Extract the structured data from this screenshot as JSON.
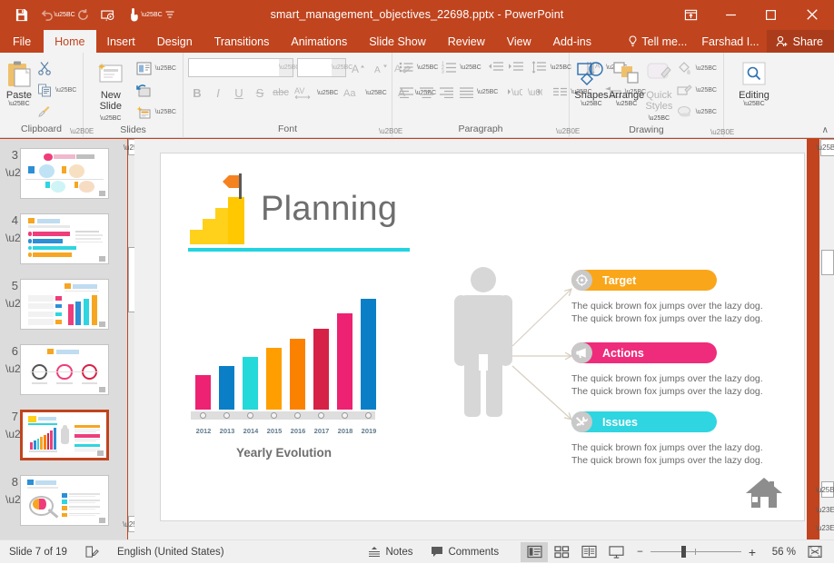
{
  "window": {
    "title": "smart_management_objectives_22698.pptx - PowerPoint",
    "accent_color": "#C0441E",
    "quick_access": [
      {
        "name": "save",
        "glyph": "ὋE"
      },
      {
        "name": "undo",
        "glyph": "↶"
      },
      {
        "name": "redo",
        "glyph": "↻"
      },
      {
        "name": "start-presentation",
        "glyph": "▶"
      },
      {
        "name": "touch-mode",
        "glyph": "☝"
      },
      {
        "name": "customize-qat",
        "glyph": "⯆"
      }
    ],
    "controls": {
      "ribbon_display": "⤒",
      "minimize": "—",
      "maximize": "□",
      "close": "✕"
    }
  },
  "ribbon": {
    "tabs": [
      {
        "label": "File",
        "active": false
      },
      {
        "label": "Home",
        "active": true
      },
      {
        "label": "Insert",
        "active": false
      },
      {
        "label": "Design",
        "active": false
      },
      {
        "label": "Transitions",
        "active": false
      },
      {
        "label": "Animations",
        "active": false
      },
      {
        "label": "Slide Show",
        "active": false
      },
      {
        "label": "Review",
        "active": false
      },
      {
        "label": "View",
        "active": false
      },
      {
        "label": "Add-ins",
        "active": false
      }
    ],
    "tell_me": "Tell me...",
    "user_name": "Farshad I...",
    "share_label": "Share",
    "collapse_glyph": "∧",
    "groups": {
      "clipboard": {
        "label": "Clipboard",
        "paste_label": "Paste",
        "items": [
          "Cut",
          "Copy",
          "Format Painter"
        ]
      },
      "slides": {
        "label": "Slides",
        "new_slide_label": "New\nSlide",
        "new_slide_line1": "New",
        "new_slide_line2": "Slide",
        "items": [
          "Layout",
          "Reset",
          "Section"
        ]
      },
      "font": {
        "label": "Font",
        "font_name_value": "",
        "font_name_placeholder": "",
        "font_size_value": "",
        "font_size_placeholder": "",
        "buttons": [
          "B",
          "I",
          "U",
          "S",
          "abc",
          "AV",
          "Aa",
          "A"
        ]
      },
      "paragraph": {
        "label": "Paragraph"
      },
      "drawing": {
        "label": "Drawing",
        "shapes_label": "Shapes",
        "arrange_label": "Arrange",
        "quick_styles_line1": "Quick",
        "quick_styles_line2": "Styles"
      },
      "editing": {
        "label": "Editing",
        "editing_label": "Editing"
      }
    }
  },
  "thumbnails": [
    {
      "number": "3",
      "selected": false,
      "starred": true,
      "title": "Specific Milestones"
    },
    {
      "number": "4",
      "selected": false,
      "starred": true,
      "title": "Measurable"
    },
    {
      "number": "5",
      "selected": false,
      "starred": true,
      "title": "Measurable"
    },
    {
      "number": "6",
      "selected": false,
      "starred": true,
      "title": "Attainable"
    },
    {
      "number": "7",
      "selected": true,
      "starred": true,
      "title": "Planning"
    },
    {
      "number": "8",
      "selected": false,
      "starred": true,
      "title": "Relevant"
    }
  ],
  "slide": {
    "title": "Planning",
    "title_color": "#6E6E6E",
    "underline_color": "#22D3E0",
    "chart_caption": "Yearly Evolution",
    "home_icon": "home-icon",
    "items": [
      {
        "label": "Target",
        "color": "#FAA61A",
        "icon": "target-crosshair-icon",
        "body_line1": "The quick brown fox jumps over the lazy dog.",
        "body_line2": "The quick brown fox jumps over the lazy dog."
      },
      {
        "label": "Actions",
        "color": "#EE2C7B",
        "icon": "megaphone-icon",
        "body_line1": "The quick brown fox jumps over the lazy dog.",
        "body_line2": "The quick brown fox jumps over the lazy dog."
      },
      {
        "label": "Issues",
        "color": "#2FD5E0",
        "icon": "tools-icon",
        "body_line1": "The quick brown fox jumps over the lazy dog.",
        "body_line2": "The quick brown fox jumps over the lazy dog."
      }
    ]
  },
  "chart_data": {
    "type": "bar",
    "title": "Yearly Evolution",
    "xlabel": "",
    "ylabel": "",
    "categories": [
      "2012",
      "2013",
      "2014",
      "2015",
      "2016",
      "2017",
      "2018",
      "2019"
    ],
    "values": [
      38,
      48,
      58,
      68,
      78,
      89,
      106,
      122
    ],
    "ylim": [
      0,
      130
    ],
    "grid": false,
    "legend": false,
    "colors": [
      "#ED2272",
      "#0A7FC8",
      "#23D9D9",
      "#FF9E00",
      "#FB8200",
      "#D62246",
      "#ED2272",
      "#0A7FC8"
    ]
  },
  "status_bar": {
    "slide_counter": "Slide 7 of 19",
    "language": "English (United States)",
    "notes_label": "Notes",
    "comments_label": "Comments",
    "zoom_level": "56 %",
    "views": [
      "normal-view",
      "slide-sorter-view",
      "reading-view",
      "slideshow-view"
    ],
    "zoom_out": "−",
    "zoom_in": "+"
  }
}
